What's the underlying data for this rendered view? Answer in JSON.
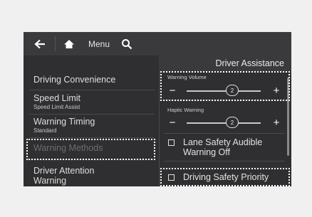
{
  "toolbar": {
    "back_icon": "arrow-left-icon",
    "home_icon": "home-icon",
    "menu_label": "Menu",
    "search_icon": "search-icon"
  },
  "header": {
    "title": "Driver Assistance"
  },
  "left_menu": {
    "items": [
      {
        "label": "Driving Convenience",
        "sub": ""
      },
      {
        "label": "Speed Limit",
        "sub": "Speed Limit Assist"
      },
      {
        "label": "Warning Timing",
        "sub": "Standard"
      },
      {
        "label": "Warning Methods",
        "sub": "",
        "disabled": true
      },
      {
        "label": "Driver Attention",
        "sub": "Warning"
      }
    ]
  },
  "right_panel": {
    "warning_volume": {
      "label": "Warning Volume",
      "value": "2",
      "minus": "−",
      "plus": "+"
    },
    "haptic_warning": {
      "label": "Haptic Warning",
      "value": "2",
      "minus": "−",
      "plus": "+"
    },
    "lane_safety": {
      "label_line1": "Lane Safety Audible",
      "label_line2": "Warning Off",
      "checked": false
    },
    "driving_safety_priority": {
      "label": "Driving Safety Priority",
      "checked": false
    }
  },
  "colors": {
    "screen_bg": "#2f2f31",
    "bar_bg": "#3a3a3c",
    "highlight": "#ffffff"
  }
}
